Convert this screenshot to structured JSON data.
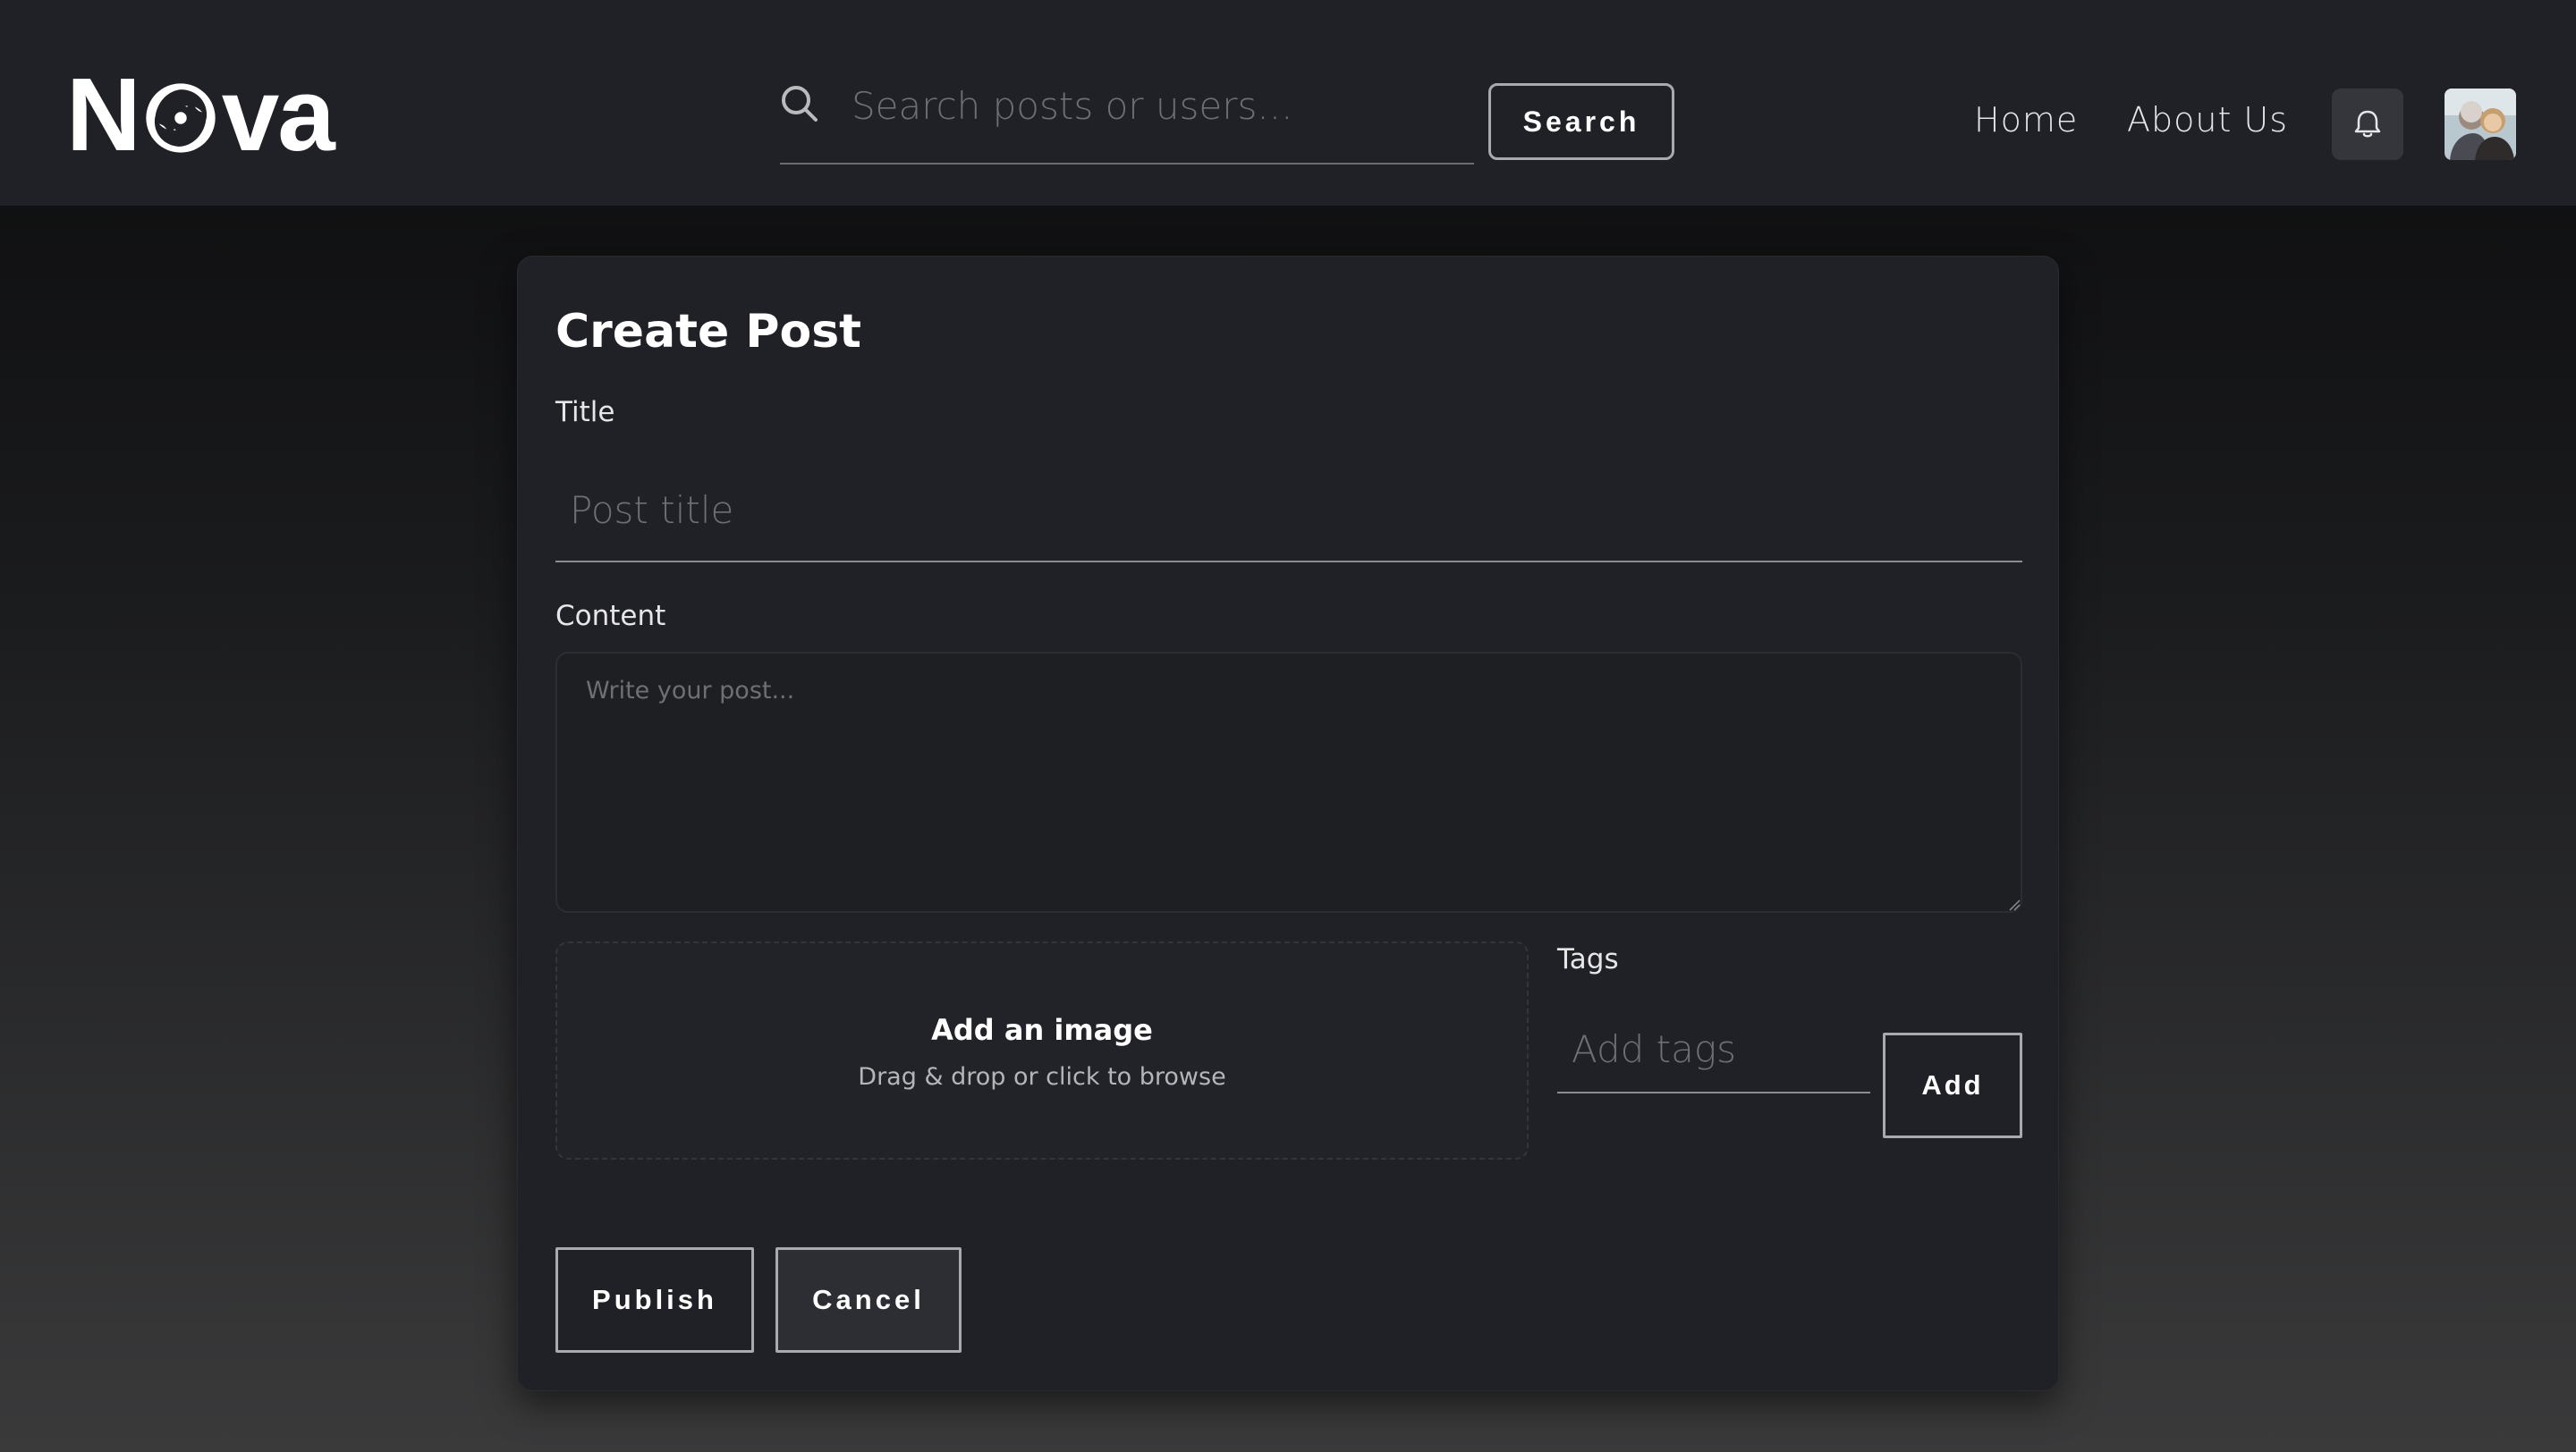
{
  "header": {
    "logo_text_1": "N",
    "logo_text_2": "va",
    "search_placeholder": "Search posts or users...",
    "search_button_label": "Search",
    "nav": {
      "home": "Home",
      "about": "About Us"
    },
    "bell_icon": "bell-icon",
    "avatar_icon": "user-avatar"
  },
  "form": {
    "title": "Create Post",
    "title_label": "Title",
    "title_placeholder": "Post title",
    "title_value": "",
    "content_label": "Content",
    "content_placeholder": "Write your post...",
    "content_value": "",
    "dropzone_title": "Add an image",
    "dropzone_subtitle": "Drag & drop or click to browse",
    "tags_label": "Tags",
    "tags_placeholder": "Add tags",
    "tags_value": "",
    "add_button_label": "Add",
    "publish_button_label": "Publish",
    "cancel_button_label": "Cancel"
  },
  "colors": {
    "header_bg": "#202126",
    "card_bg": "#202126",
    "button_border": "#a9aaad",
    "placeholder": "#6e6f74"
  }
}
